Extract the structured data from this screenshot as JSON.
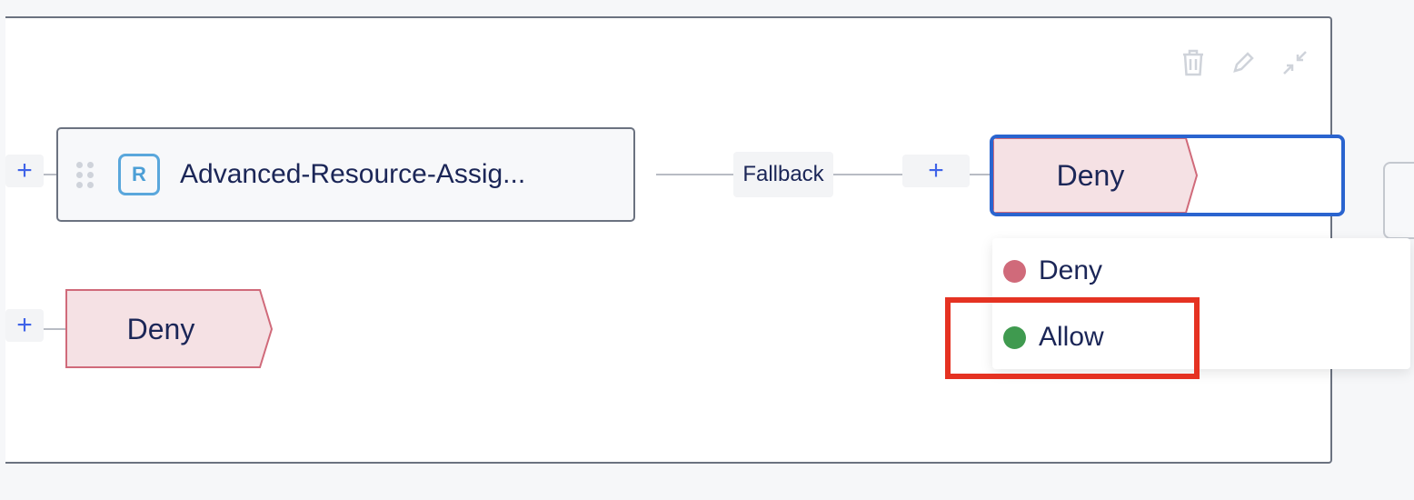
{
  "canvas": {
    "toolbar": {
      "delete_icon": "trash-icon",
      "edit_icon": "pencil-icon",
      "collapse_icon": "collapse-icon"
    },
    "resource_node": {
      "badge": "R",
      "name": "Advanced-Resource-Assig..."
    },
    "fallback_label": "Fallback",
    "selected_effect": "Deny",
    "secondary_effect": "Deny",
    "dropdown": {
      "options": [
        {
          "label": "Deny",
          "color": "#d06a7a"
        },
        {
          "label": "Allow",
          "color": "#3f9a4f"
        }
      ],
      "highlighted": "Allow"
    },
    "add_label": "+"
  },
  "colors": {
    "accent_blue": "#2a64cf",
    "plus_blue": "#3f63e8",
    "deny_fill": "#f5e1e4",
    "deny_stroke": "#d06a7a",
    "highlight_red": "#e53222"
  }
}
